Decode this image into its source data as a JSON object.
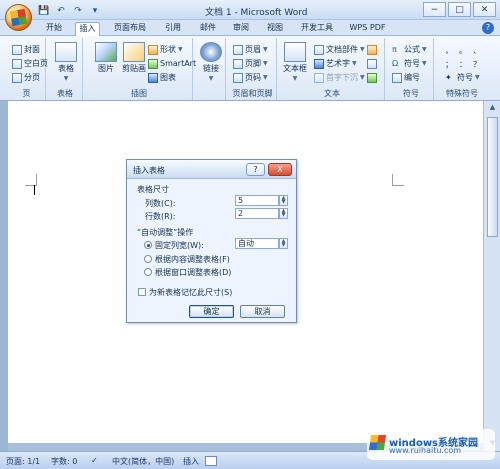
{
  "window": {
    "title": "文档 1 - Microsoft Word",
    "controls": [
      "−",
      "□",
      "✕"
    ]
  },
  "quick_access": [
    "💾",
    "↶",
    "↷",
    "▾"
  ],
  "tabs": [
    "开始",
    "插入",
    "页面布局",
    "引用",
    "邮件",
    "审阅",
    "视图",
    "开发工具",
    "WPS PDF"
  ],
  "ribbon": {
    "pages_group": {
      "label": "页",
      "items": [
        "封面",
        "空白页",
        "分页"
      ]
    },
    "table_group": {
      "label": "表格",
      "button": "表格"
    },
    "illustrations_group": {
      "label": "插图",
      "buttons": [
        "图片",
        "剪贴画"
      ],
      "items": [
        "形状",
        "SmartArt",
        "图表"
      ]
    },
    "links_group": {
      "label": "",
      "button": "链接"
    },
    "header_footer_group": {
      "label": "页眉和页脚",
      "items": [
        "页眉",
        "页脚",
        "页码"
      ]
    },
    "text_group": {
      "label": "文本",
      "button": "文本框",
      "items": [
        "文档部件",
        "艺术字",
        "首字下沉"
      ]
    },
    "symbols_group": {
      "label": "符号",
      "items": [
        "公式",
        "符号",
        "编号"
      ]
    },
    "special_symbols_group": {
      "label": "特殊符号",
      "symbols": [
        "，",
        "。",
        "、",
        "；",
        "：",
        "？"
      ],
      "item": "符号"
    }
  },
  "dialog": {
    "title": "插入表格",
    "help": "?",
    "close": "X",
    "size_section": "表格尺寸",
    "columns_label": "列数(C):",
    "columns_value": "5",
    "rows_label": "行数(R):",
    "rows_value": "2",
    "autofit_section": "“自动调整”操作",
    "fixed_width_label": "固定列宽(W):",
    "fixed_width_value": "自动",
    "fit_contents_label": "根据内容调整表格(F)",
    "fit_window_label": "根据窗口调整表格(D)",
    "remember_label": "为新表格记忆此尺寸(S)",
    "ok": "确定",
    "cancel": "取消"
  },
  "status": {
    "page": "页面: 1/1",
    "words": "字数: 0",
    "language": "中文(简体，中国)",
    "mode": "插入"
  },
  "watermark": {
    "brand": "windows系统家园",
    "site": "www.ruihaitu.com"
  },
  "colors": {
    "ribbon": "#dce8f7",
    "workspace": "#a8bfdc",
    "accent": "#165bb4"
  }
}
